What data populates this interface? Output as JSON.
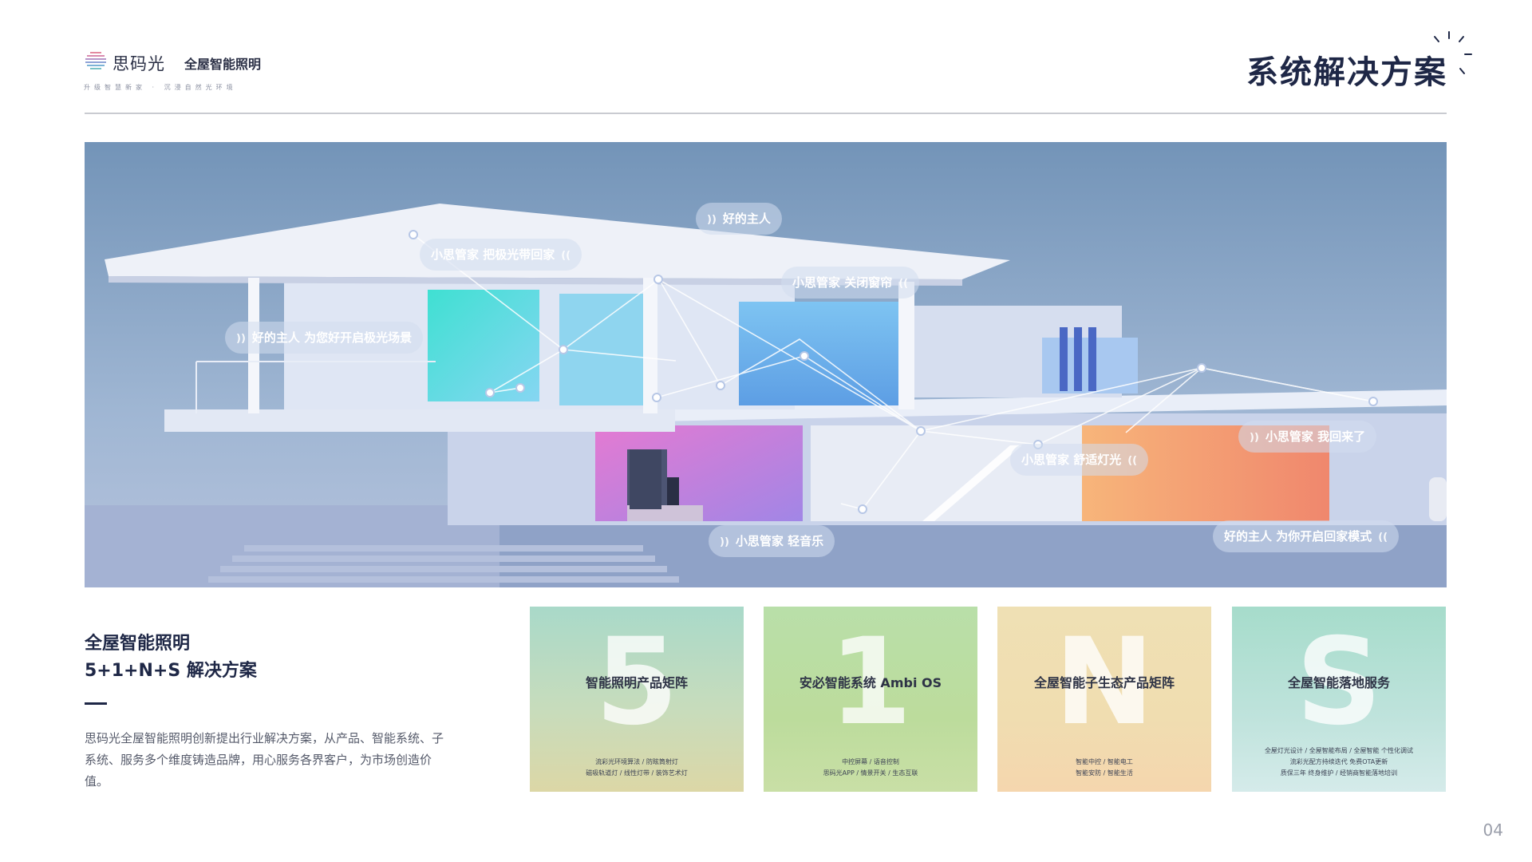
{
  "header": {
    "brand": "思码光",
    "product": "全屋智能照明",
    "slogan": "升级智慧新家 · 沉浸自然光环境",
    "page_title": "系统解决方案"
  },
  "hero": {
    "bubbles": [
      "好的主人",
      "小思管家  把极光带回家",
      "小思管家  关闭窗帘",
      "好的主人 为您好开启极光场景",
      "小思管家  我回来了",
      "小思管家  舒适灯光",
      "好的主人  为你开启回家模式",
      "小思管家  轻音乐"
    ]
  },
  "solution": {
    "title_line1": "全屋智能照明",
    "title_line2": "5+1+N+S 解决方案",
    "description": "思码光全屋智能照明创新提出行业解决方案，从产品、智能系统、子系统、服务多个维度铸造品牌，用心服务各界客户，为市场创造价值。"
  },
  "cards": [
    {
      "letter": "5",
      "title": "智能照明产品矩阵",
      "lines": [
        "流彩光环境算法 / 防眩筒射灯",
        "磁吸轨道灯 / 线性灯带 / 装饰艺术灯"
      ]
    },
    {
      "letter": "1",
      "title": "安必智能系统 Ambi OS",
      "lines": [
        "中控屏幕 / 语音控制",
        "思码光APP / 情景开关 / 生态互联"
      ]
    },
    {
      "letter": "N",
      "title": "全屋智能子生态产品矩阵",
      "lines": [
        "智能中控 / 智能电工",
        "智能安防 / 智能生活"
      ]
    },
    {
      "letter": "S",
      "title": "全屋智能落地服务",
      "lines": [
        "全屋灯光设计 / 全屋智能布局 / 全屋智能 个性化调试",
        "流彩光配方持续迭代 免费OTA更新",
        "质保三年 终身维护 / 经销商智能落地培训"
      ]
    }
  ],
  "page_number": "04",
  "colors": {
    "title": "#1e2746",
    "sky": "#7f9cc0",
    "accent_cyan": "#3fd6d6",
    "accent_pink": "#e070c8",
    "accent_warm": "#f2a070"
  }
}
